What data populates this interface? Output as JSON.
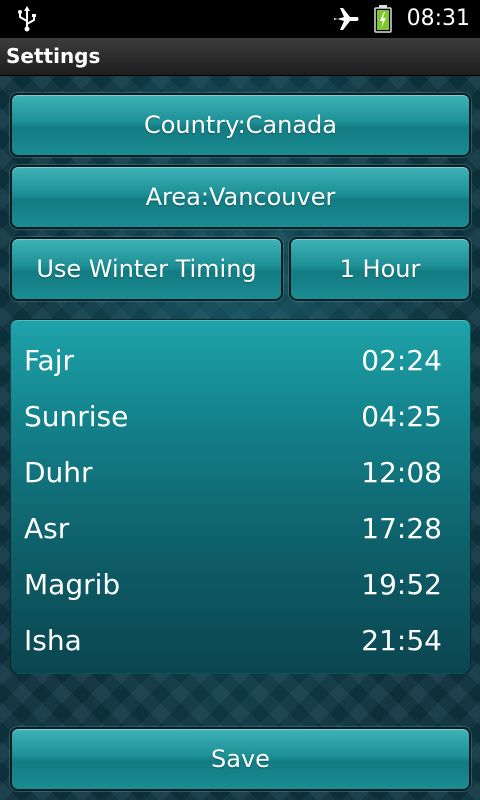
{
  "status_bar": {
    "time": "08:31",
    "icons": [
      "usb-icon",
      "airplane-mode-icon",
      "battery-charging-icon"
    ],
    "battery_color": "#7ec630"
  },
  "title_bar": {
    "title": "Settings"
  },
  "buttons": {
    "country": "Country:Canada",
    "area": "Area:Vancouver",
    "winter_timing": "Use Winter Timing",
    "hour": "1 Hour",
    "save": "Save"
  },
  "prayers": [
    {
      "name": "Fajr",
      "time": "02:24"
    },
    {
      "name": "Sunrise",
      "time": "04:25"
    },
    {
      "name": "Duhr",
      "time": "12:08"
    },
    {
      "name": "Asr",
      "time": "17:28"
    },
    {
      "name": "Magrib",
      "time": "19:52"
    },
    {
      "name": "Isha",
      "time": "21:54"
    }
  ],
  "colors": {
    "accent": "#1d8f96",
    "panel": "#138089"
  }
}
